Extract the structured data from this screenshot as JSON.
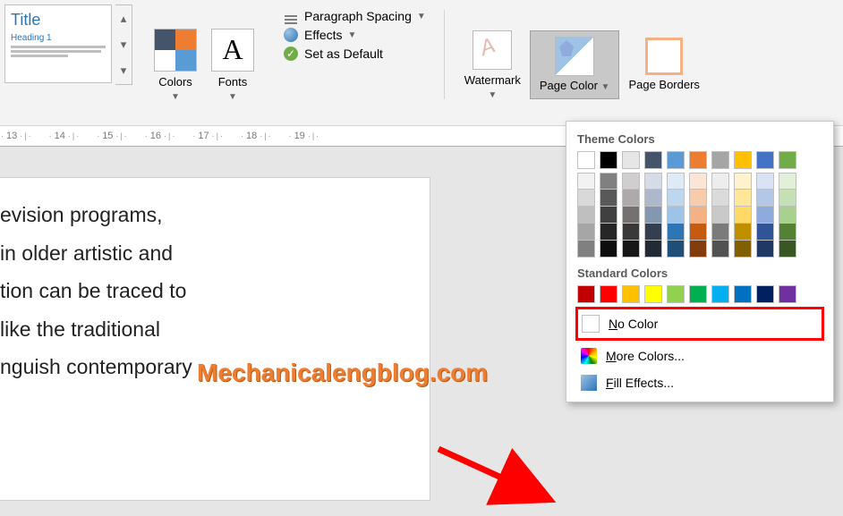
{
  "ribbon": {
    "style_preview": {
      "title": "Title",
      "heading": "Heading 1"
    },
    "colors_label": "Colors",
    "fonts_label": "Fonts",
    "paragraph_spacing": "Paragraph Spacing",
    "effects": "Effects",
    "set_as_default": "Set as Default",
    "watermark": "Watermark",
    "page_color": "Page Color",
    "page_borders": "Page Borders"
  },
  "ruler": {
    "numbers": [
      "13",
      "14",
      "15",
      "16",
      "17",
      "18",
      "19"
    ]
  },
  "document_lines": [
    "evision programs,",
    "in older artistic and",
    "tion can be traced to",
    "like the traditional",
    "nguish contemporary"
  ],
  "watermark": "Mechanicalengblog.com",
  "popup": {
    "theme_label": "Theme Colors",
    "standard_label": "Standard Colors",
    "no_color": "No Color",
    "more_colors": "More Colors...",
    "fill_effects": "Fill Effects...",
    "theme_main": [
      "#ffffff",
      "#000000",
      "#44546a",
      "#5b9bd5",
      "#ed7d31",
      "#a5a5a5",
      "#ffc000",
      "#4472c4",
      "#70ad47"
    ],
    "theme_main_extra": "#e7e6e6",
    "theme_tints": [
      [
        "#f2f2f2",
        "#d9d9d9",
        "#bfbfbf",
        "#a6a6a6",
        "#808080"
      ],
      [
        "#808080",
        "#595959",
        "#404040",
        "#262626",
        "#0d0d0d"
      ],
      [
        "#d0cece",
        "#aeaaaa",
        "#767171",
        "#3b3838",
        "#181717"
      ],
      [
        "#d6dce5",
        "#adb9ca",
        "#8497b0",
        "#333f50",
        "#222a35"
      ],
      [
        "#deebf7",
        "#bdd7ee",
        "#9dc3e6",
        "#2e75b6",
        "#1f4e79"
      ],
      [
        "#fbe5d6",
        "#f8cbad",
        "#f4b183",
        "#c55a11",
        "#843c0c"
      ],
      [
        "#ededed",
        "#dbdbdb",
        "#c9c9c9",
        "#7b7b7b",
        "#525252"
      ],
      [
        "#fff2cc",
        "#ffe699",
        "#ffd966",
        "#bf8f00",
        "#806000"
      ],
      [
        "#dae3f3",
        "#b4c7e7",
        "#8faadc",
        "#2f5597",
        "#203864"
      ],
      [
        "#e2f0d9",
        "#c5e0b4",
        "#a9d18e",
        "#548235",
        "#385723"
      ]
    ],
    "standard_colors": [
      "#c00000",
      "#ff0000",
      "#ffc000",
      "#ffff00",
      "#92d050",
      "#00b050",
      "#00b0f0",
      "#0070c0",
      "#002060",
      "#7030a0"
    ]
  }
}
